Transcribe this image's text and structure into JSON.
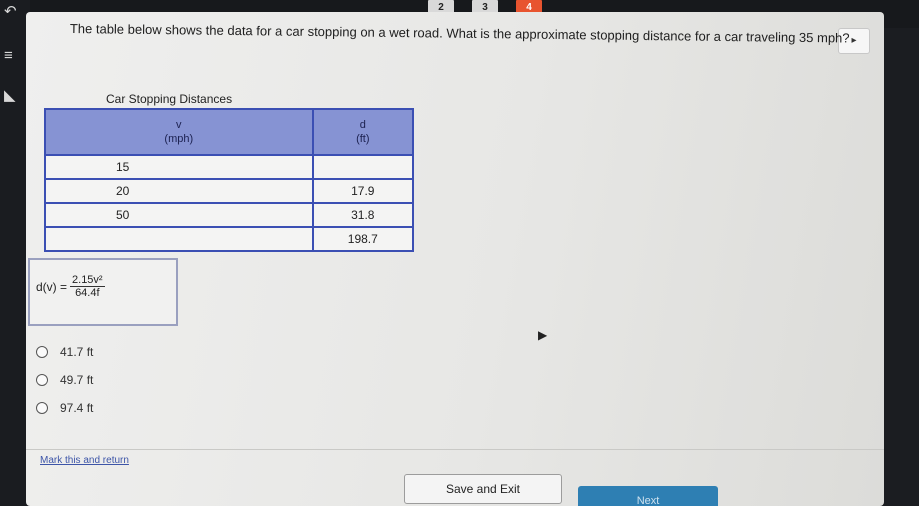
{
  "question_tabs": [
    "2",
    "3",
    "4"
  ],
  "rail": {
    "top_icon": "↶",
    "menu_icon": "≡",
    "back_icon": "◣"
  },
  "flag_icon": "▸",
  "question": {
    "text": "The table below shows the data for a car stopping on a wet road. What is the approximate stopping distance for a car traveling 35 mph?"
  },
  "table": {
    "caption": "Car Stopping Distances",
    "headers": [
      {
        "symbol": "v",
        "unit": "(mph)"
      },
      {
        "symbol": "d",
        "unit": "(ft)"
      }
    ],
    "rows": [
      [
        "15",
        ""
      ],
      [
        "20",
        "17.9"
      ],
      [
        "50",
        "31.8"
      ],
      [
        "",
        "198.7"
      ]
    ]
  },
  "formula": {
    "lhs": "d(v) =",
    "numerator": "2.15v²",
    "denominator": "64.4f"
  },
  "options": [
    "41.7 ft",
    "49.7 ft",
    "97.4 ft"
  ],
  "mark_link": "Mark this and return",
  "save_exit": "Save and Exit",
  "next": "Next",
  "colors": {
    "header_fill": "#8693d3",
    "table_border": "#3b4fb3",
    "current_tab": "#e8542f",
    "next_button": "#2e7fb3"
  }
}
